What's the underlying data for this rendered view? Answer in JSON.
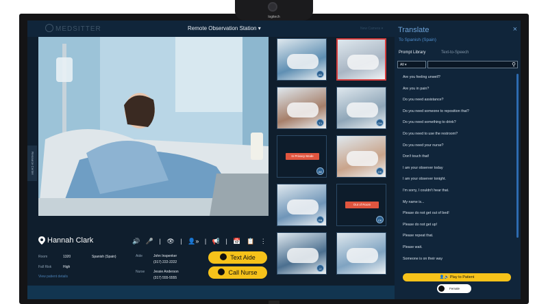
{
  "camera": {
    "brand": "logitech"
  },
  "header": {
    "logo": "MEDSITTER",
    "station_title": "Remote Observation Station",
    "station_caret": "▾",
    "new_camera": "New Camera ▾"
  },
  "sidebar": {
    "resource_center": "Resource Center"
  },
  "main_view": {
    "overlay_glyph": "A",
    "patient_name": "Hannah Clark",
    "room_label": "Room",
    "room_value": "1320",
    "fall_label": "Fall Risk",
    "fall_value": "High",
    "language": "Spanish (Spain)",
    "view_details": "View patient details",
    "aide_label": "Aide",
    "aide_name": "John Inspenker",
    "aide_phone": "(317) 222-2222",
    "nurse_label": "Nurse",
    "nurse_name": "Jessie Anderson",
    "nurse_phone": "(317) 555-5555",
    "text_aide": "Text Aide",
    "call_nurse": "Call Nurse"
  },
  "thumbnails": [
    {
      "badge": "AD",
      "type": "image",
      "tone": "#5f8fb3"
    },
    {
      "badge": "",
      "type": "image",
      "tone": "#a9b6c4",
      "selected": true
    },
    {
      "badge": "TJ",
      "type": "image",
      "tone": "#a67f6a"
    },
    {
      "badge": "CM",
      "type": "image",
      "tone": "#8fa6b8"
    },
    {
      "badge": "AK",
      "type": "status",
      "label": "In Privacy Mode"
    },
    {
      "badge": "GK",
      "type": "image",
      "tone": "#c9a48b"
    },
    {
      "badge": "RB",
      "type": "image",
      "tone": "#6f95b8"
    },
    {
      "badge": "CK",
      "type": "status",
      "label": "Out of Room"
    },
    {
      "badge": "JJ",
      "type": "image",
      "tone": "#4b6f8f"
    },
    {
      "badge": "",
      "type": "image",
      "tone": "#7fa3c1"
    }
  ],
  "translate": {
    "title": "Translate",
    "close": "×",
    "language": "To Spanish (Spain)",
    "tab_prompt": "Prompt Library",
    "tab_tts": "Text-to-Speech",
    "filter": "All",
    "search_placeholder": "",
    "prompts": [
      "Are you feeling unwell?",
      "Are you in pain?",
      "Do you need assistance?",
      "Do you need someone to reposition that?",
      "Do you need something to drink?",
      "Do you need to use the restroom?",
      "Do you need your nurse?",
      "Don't touch that!",
      "I am your observer today",
      "I am your observer tonight.",
      "I'm sorry, I couldn't hear that.",
      "My name is...",
      "Please do not get out of bed!",
      "Please do not get up!",
      "Please repeat that.",
      "Please wait.",
      "Someone is on their way"
    ],
    "play_button": "Play to Patient",
    "voice": "Female"
  }
}
